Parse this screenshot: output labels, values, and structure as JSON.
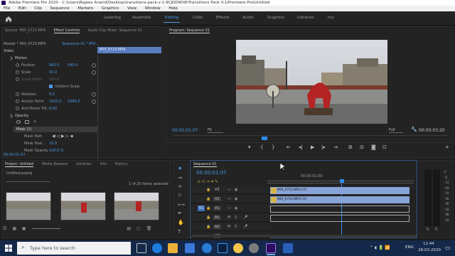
{
  "window": {
    "title": "Adobe Premiere Pro 2020 - C:\\Users\\Rajeev Anand\\Desktop\\transitions-pack-v-1-9CJDDW\\W\\Transitions Pack V.1\\Premiere Pro\\Untitled"
  },
  "menu": {
    "items": [
      "File",
      "Edit",
      "Clip",
      "Sequence",
      "Markers",
      "Graphics",
      "View",
      "Window",
      "Help"
    ]
  },
  "workspaces": {
    "items": [
      "Learning",
      "Assembly",
      "Editing",
      "Color",
      "Effects",
      "Audio",
      "Graphics",
      "Libraries",
      "my"
    ],
    "active": "Editing"
  },
  "source_panel": {
    "tabs": [
      "Source: MVI_0723.MP4",
      "Effect Controls",
      "Audio Clip Mixer: Sequence 01"
    ],
    "master_label": "Master * MVI_0723.MP4",
    "sequence_label": "Sequence 01 * MVI...",
    "clip_chip": "MVI_0723.MP4",
    "section_video": "Video",
    "props": {
      "motion": "Motion",
      "position": {
        "label": "Position",
        "x": "960.0",
        "y": "540.0"
      },
      "scale": {
        "label": "Scale",
        "value": "50.0"
      },
      "scale_width": {
        "label": "Scale Width",
        "value": "100.0"
      },
      "uniform_scale": "Uniform Scale",
      "rotation": {
        "label": "Rotation",
        "value": "0.0"
      },
      "anchor": {
        "label": "Anchor Point",
        "x": "1920.0",
        "y": "1080.0"
      },
      "anti_flicker": {
        "label": "Anti-flicker Filt...",
        "value": "0.00"
      },
      "opacity": "Opacity",
      "mask": "Mask (1)",
      "mask_path": "Mask Path",
      "mask_feather": {
        "label": "Mask Feat...",
        "value": "10.0"
      },
      "mask_opacity": {
        "label": "Mask Opacity",
        "value": "100.0 %"
      }
    },
    "timecode": "00:00:01:07"
  },
  "program": {
    "tab": "Program: Sequence 01",
    "timecode_left": "00:00:01:07",
    "fit": "Fit",
    "quality": "Full",
    "timecode_right": "00:00:03:20"
  },
  "project": {
    "tabs": [
      "Project: Untitled",
      "Media Browser",
      "Libraries",
      "Info",
      "History"
    ],
    "file": "Untitled.prproj",
    "count": "1 of 20 items selected"
  },
  "timeline": {
    "tab": "Sequence 01",
    "timecode": "00:00:01:07",
    "ruler_time": "00:00:01:00",
    "tracks": [
      "V3",
      "V2",
      "V1",
      "A1",
      "A2",
      "A3"
    ],
    "clips": {
      "v2": "MVI_0723.MP4 [V]",
      "v1": "MVI_0724.MP4 [V]"
    }
  },
  "meter": {
    "labels": [
      "0",
      "-6",
      "-12",
      "-18",
      "-24",
      "-30",
      "-36",
      "-42",
      "-48",
      "-54"
    ],
    "bottom": [
      "S",
      "S"
    ]
  },
  "taskbar": {
    "search_placeholder": "Type here to search",
    "lang": "ENG",
    "time": "11:44",
    "date": "28-03-2020"
  },
  "colors": {
    "accent": "#4a9ae6",
    "clip": "#88a3d7",
    "program_accent": "#2d8ceb"
  }
}
